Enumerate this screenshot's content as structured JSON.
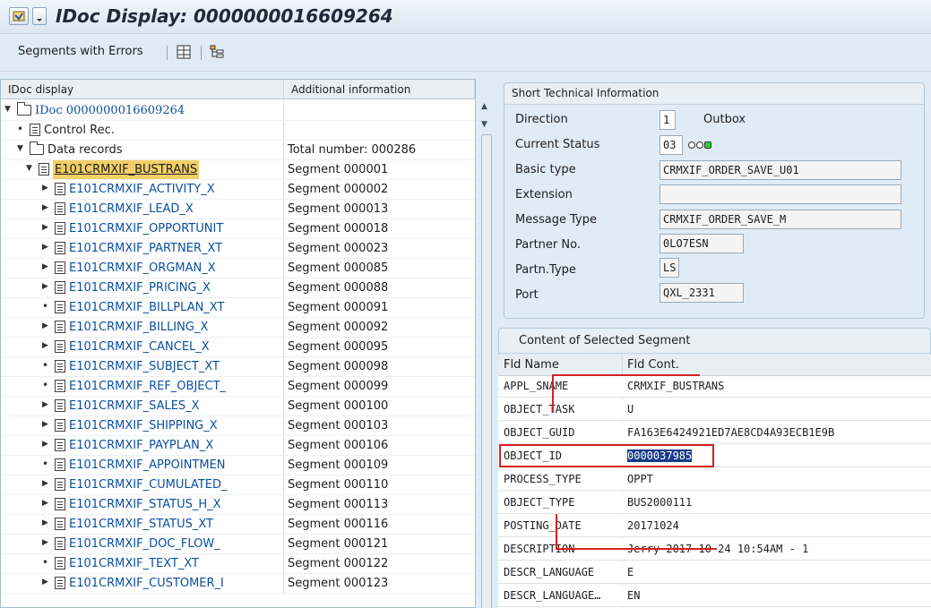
{
  "window": {
    "title": "IDoc Display: 0000000016609264"
  },
  "toolbar": {
    "segments_with_errors": "Segments with Errors"
  },
  "tree": {
    "headers": {
      "col1": "IDoc display",
      "col2": "Additional information"
    },
    "rows": [
      {
        "label": "IDoc 0000000016609264",
        "info": ""
      },
      {
        "label": "Control Rec.",
        "info": ""
      },
      {
        "label": "Data records",
        "info": "Total number: 000286"
      },
      {
        "label": "E101CRMXIF_BUSTRANS",
        "info": "Segment 000001"
      },
      {
        "label": "E101CRMXIF_ACTIVITY_X",
        "info": "Segment 000002"
      },
      {
        "label": "E101CRMXIF_LEAD_X",
        "info": "Segment 000013"
      },
      {
        "label": "E101CRMXIF_OPPORTUNIT",
        "info": "Segment 000018"
      },
      {
        "label": "E101CRMXIF_PARTNER_XT",
        "info": "Segment 000023"
      },
      {
        "label": "E101CRMXIF_ORGMAN_X",
        "info": "Segment 000085"
      },
      {
        "label": "E101CRMXIF_PRICING_X",
        "info": "Segment 000088"
      },
      {
        "label": "E101CRMXIF_BILLPLAN_XT",
        "info": "Segment 000091"
      },
      {
        "label": "E101CRMXIF_BILLING_X",
        "info": "Segment 000092"
      },
      {
        "label": "E101CRMXIF_CANCEL_X",
        "info": "Segment 000095"
      },
      {
        "label": "E101CRMXIF_SUBJECT_XT",
        "info": "Segment 000098"
      },
      {
        "label": "E101CRMXIF_REF_OBJECT_",
        "info": "Segment 000099"
      },
      {
        "label": "E101CRMXIF_SALES_X",
        "info": "Segment 000100"
      },
      {
        "label": "E101CRMXIF_SHIPPING_X",
        "info": "Segment 000103"
      },
      {
        "label": "E101CRMXIF_PAYPLAN_X",
        "info": "Segment 000106"
      },
      {
        "label": "E101CRMXIF_APPOINTMEN",
        "info": "Segment 000109"
      },
      {
        "label": "E101CRMXIF_CUMULATED_",
        "info": "Segment 000110"
      },
      {
        "label": "E101CRMXIF_STATUS_H_X",
        "info": "Segment 000113"
      },
      {
        "label": "E101CRMXIF_STATUS_XT",
        "info": "Segment 000116"
      },
      {
        "label": "E101CRMXIF_DOC_FLOW_",
        "info": "Segment 000121"
      },
      {
        "label": "E101CRMXIF_TEXT_XT",
        "info": "Segment 000122"
      },
      {
        "label": "E101CRMXIF_CUSTOMER_I",
        "info": "Segment 000123"
      }
    ]
  },
  "tech_info": {
    "title": "Short Technical Information",
    "direction_label": "Direction",
    "direction_value": "1",
    "direction_text": "Outbox",
    "status_label": "Current Status",
    "status_value": "03",
    "basic_type_label": "Basic type",
    "basic_type_value": "CRMXIF_ORDER_SAVE_U01",
    "extension_label": "Extension",
    "extension_value": "",
    "message_type_label": "Message Type",
    "message_type_value": "CRMXIF_ORDER_SAVE_M",
    "partner_no_label": "Partner No.",
    "partner_no_value": "0LO7ESN",
    "partn_type_label": "Partn.Type",
    "partn_type_value": "LS",
    "port_label": "Port",
    "port_value": "QXL_2331",
    "status_light_colors": [
      "#ffffff",
      "#ffffff",
      "#2bd12b"
    ]
  },
  "segment_content": {
    "title": "Content of Selected Segment",
    "headers": {
      "name": "Fld Name",
      "value": "Fld Cont."
    },
    "rows": [
      {
        "name": "APPL_SNAME",
        "value": "CRMXIF_BUSTRANS"
      },
      {
        "name": "OBJECT_TASK",
        "value": "U"
      },
      {
        "name": "OBJECT_GUID",
        "value": "FA163E6424921ED7AE8CD4A93ECB1E9B"
      },
      {
        "name": "OBJECT_ID",
        "value": "0000037985"
      },
      {
        "name": "PROCESS_TYPE",
        "value": "OPPT"
      },
      {
        "name": "OBJECT_TYPE",
        "value": "BUS2000111"
      },
      {
        "name": "POSTING_DATE",
        "value": "20171024"
      },
      {
        "name": "DESCRIPTION",
        "value": "Jerry 2017-10-24 10:54AM - 1"
      },
      {
        "name": "DESCR_LANGUAGE",
        "value": "E"
      },
      {
        "name": "DESCR_LANGUAGE…",
        "value": "EN"
      }
    ]
  }
}
